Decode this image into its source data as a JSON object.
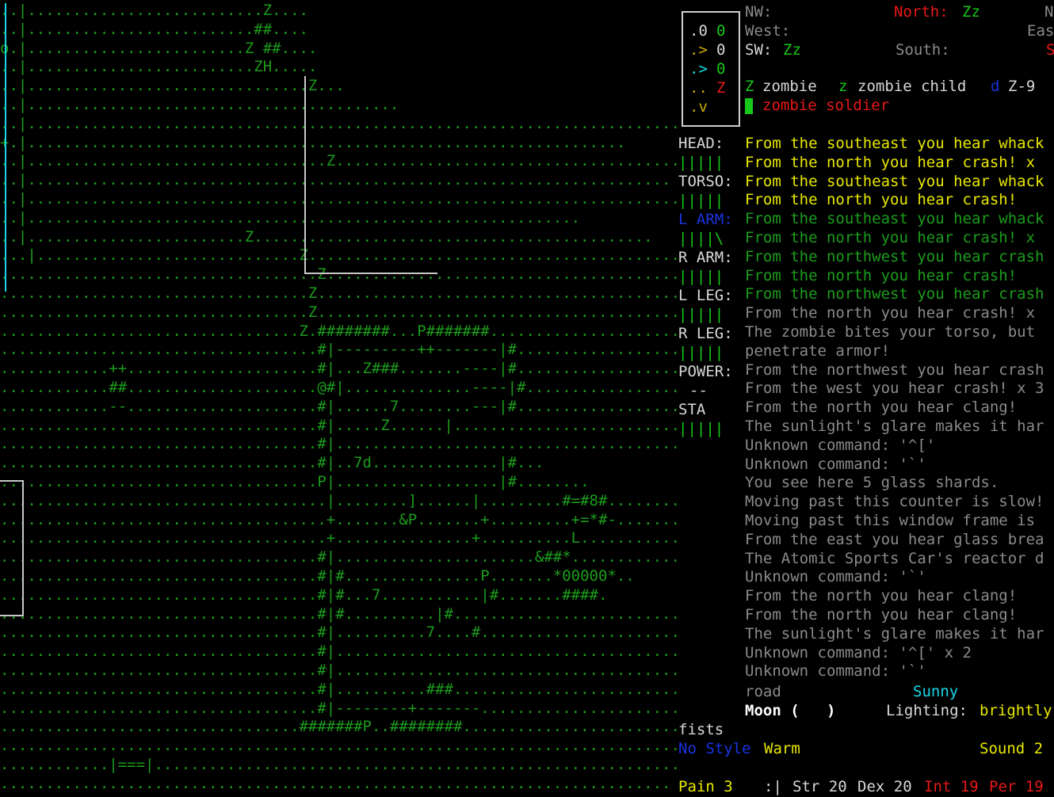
{
  "colors": {
    "background": "#000000",
    "zombie": "#18c818",
    "hostile": "#e81818",
    "warning": "#e8e800",
    "info": "#18d8e8",
    "old_message": "#8a8a8a",
    "player": "#ffffff"
  },
  "map": {
    "rows": [
      {
        "text": "..|..........................Z....",
        "color": "dg"
      },
      {
        "text": "..|.........................##....",
        "color": "dg"
      },
      {
        "text": "o.|........................Z ##....",
        "color": "dg"
      },
      {
        "text": "..|.........................ZH.....",
        "color": "dg"
      },
      {
        "text": "..|...............................Z...",
        "color": "dg"
      },
      {
        "text": "..|.........................................",
        "color": "dg"
      },
      {
        "text": "..|............................................................................",
        "color": "dg"
      },
      {
        "text": "+.|..................................................................",
        "color": "dg"
      },
      {
        "text": "..|.................................Z.........................................",
        "color": "dg"
      },
      {
        "text": "..|.......................................................................",
        "color": "dg"
      },
      {
        "text": "..|............................................................................",
        "color": "dg"
      },
      {
        "text": "..|.............................................................",
        "color": "dg"
      },
      {
        "text": "..|........................Z............................................",
        "color": "dg"
      },
      {
        "text": "...|.............................Z.............................................",
        "color": "dg"
      },
      {
        "text": "...................................Z...........................................",
        "color": "dg"
      },
      {
        "text": "..................................Z............................................",
        "color": "dg"
      },
      {
        "text": "..................................Z.........................................",
        "color": "dg"
      },
      {
        "text": ".................................Z.########...P#######...........................",
        "color": "dg"
      },
      {
        "text": "...................................#|---------++-------|#...........................",
        "color": "dg"
      },
      {
        "text": "............++.....................#|...Z###.......----|#..........................",
        "color": "dg"
      },
      {
        "text": "............##.....................@#|..............----|#.........................",
        "color": "dg"
      },
      {
        "text": "............--.....................#|......7........---|#.........................",
        "color": "dg"
      },
      {
        "text": "...................................#|.....Z......|...........................",
        "color": "dg"
      },
      {
        "text": "...................................#|.........................................",
        "color": "dg"
      },
      {
        "text": "...................................#|..7d..............|#...",
        "color": "dg"
      },
      {
        "text": "...................................P|..................|#........",
        "color": "dg"
      },
      {
        "text": "....................................|........]......|.........#=#8#.............",
        "color": "dg"
      },
      {
        "text": "....................................+.......&P.......+.........+=*#-.............",
        "color": "dg"
      },
      {
        "text": "....................................+...............+..........L.....................",
        "color": "dg"
      },
      {
        "text": "...................................#|......................&##*...............",
        "color": "dg"
      },
      {
        "text": "...................................#|#...............P.......*00000*..",
        "color": "dg"
      },
      {
        "text": "...................................#|#...7...........|#.......####.",
        "color": "dg"
      },
      {
        "text": "...................................#|#..........|#............................",
        "color": "dg"
      },
      {
        "text": "...................................#|..........7....#..........................",
        "color": "dg"
      },
      {
        "text": "...................................#|........................................",
        "color": "dg"
      },
      {
        "text": "...................................#|........................................",
        "color": "dg"
      },
      {
        "text": "...................................#|..........###..............................",
        "color": "dg"
      },
      {
        "text": "...................................#|--------+-------..........................",
        "color": "dg"
      },
      {
        "text": ".................................#######P..########...........................",
        "color": "dg"
      },
      {
        "text": "...........................................................................",
        "color": "dg"
      },
      {
        "text": "............|===|..........................................................",
        "color": "dg"
      },
      {
        "text": "..........................................................................",
        "color": "dg"
      }
    ]
  },
  "minimap": {
    "cells": [
      {
        "text": ".0",
        "color": "w"
      },
      {
        "text": ".>",
        "color": "br"
      },
      {
        "text": ".>",
        "color": "c"
      },
      {
        "text": "..",
        "color": "br"
      },
      {
        "text": ".v",
        "color": "br"
      }
    ],
    "col2": [
      {
        "text": "0",
        "color": "g"
      },
      {
        "text": "0",
        "color": "w"
      },
      {
        "text": "0",
        "color": "g"
      },
      {
        "text": "Z",
        "color": "r"
      },
      {
        "text": "",
        "color": "w"
      }
    ]
  },
  "compass": {
    "nw_label": "NW:",
    "north_label": "North:",
    "north_value": "Zz",
    "ne_label": "N",
    "west_label": "West:",
    "east_label": "Eas",
    "sw_label": "SW:",
    "sw_value": "Zz",
    "south_label": "South:",
    "se_label": "S"
  },
  "monsters": [
    {
      "glyph": "Z",
      "name": "zombie",
      "glyph_color": "g"
    },
    {
      "glyph": "z",
      "name": "zombie child",
      "glyph_color": "g"
    },
    {
      "glyph": "d",
      "name": "Z-9",
      "glyph_color": "b"
    }
  ],
  "monsters_line2": {
    "name": "zombie soldier"
  },
  "body": {
    "head_label": "HEAD:",
    "head_bar": "|||||",
    "torso_label": "TORSO:",
    "torso_bar": "|||||",
    "larm_label": "L ARM:",
    "larm_bar": "||||\\",
    "rarm_label": "R ARM:",
    "rarm_bar": "|||||",
    "lleg_label": "L LEG:",
    "lleg_bar": "|||||",
    "rleg_label": "R LEG:",
    "rleg_bar": "|||||",
    "power_label": "POWER:",
    "power_value": "--",
    "sta_label": "STA",
    "sta_bar": "|||||"
  },
  "messages": [
    {
      "text": "From the southeast you hear whack",
      "color": "y"
    },
    {
      "text": "From the north you hear crash! x",
      "color": "y"
    },
    {
      "text": "From the southeast you hear whack",
      "color": "y"
    },
    {
      "text": "From the north you hear crash!",
      "color": "y"
    },
    {
      "text": "From the southeast you hear whack",
      "color": "dg"
    },
    {
      "text": "From the north you hear crash! x",
      "color": "dg"
    },
    {
      "text": "From the northwest you hear crash",
      "color": "dg"
    },
    {
      "text": "From the north you hear crash!",
      "color": "dg"
    },
    {
      "text": "From the northwest you hear crash",
      "color": "dg"
    },
    {
      "text": "From the north you hear crash! x",
      "color": "gr"
    },
    {
      "text": "The zombie bites your torso, but",
      "color": "gr"
    },
    {
      "text": "penetrate armor!",
      "color": "gr"
    },
    {
      "text": "From the northwest you hear crash",
      "color": "gr"
    },
    {
      "text": "From the west you hear crash! x 3",
      "color": "gr"
    },
    {
      "text": "From the north you hear clang!",
      "color": "gr"
    },
    {
      "text": "The sunlight's glare makes it har",
      "color": "gr"
    },
    {
      "text": "Unknown command: '^['",
      "color": "gr"
    },
    {
      "text": "Unknown command: '`'",
      "color": "gr"
    },
    {
      "text": "You see here 5 glass shards.",
      "color": "gr"
    },
    {
      "text": "Moving past this counter is slow!",
      "color": "gr"
    },
    {
      "text": "Moving past this window frame is",
      "color": "gr"
    },
    {
      "text": "From the east you hear glass brea",
      "color": "gr"
    },
    {
      "text": "The Atomic Sports Car's reactor d",
      "color": "gr"
    },
    {
      "text": "Unknown command: '`'",
      "color": "gr"
    },
    {
      "text": "From the north you hear clang!",
      "color": "gr"
    },
    {
      "text": "From the north you hear clang!",
      "color": "gr"
    },
    {
      "text": "The sunlight's glare makes it har",
      "color": "gr"
    },
    {
      "text": "Unknown command: '^[' x 2",
      "color": "gr"
    },
    {
      "text": "Unknown command: '`'",
      "color": "gr"
    }
  ],
  "status": {
    "terrain": "road",
    "weather": "Sunny",
    "moon": "Moon (   )",
    "lighting_label": "Lighting:",
    "lighting_value": "brightly",
    "weapon": "fists",
    "style": "No Style",
    "temperature": "Warm",
    "sound": "Sound 2",
    "pain": "Pain 3",
    "face": ":|",
    "str": "Str 20",
    "dex": "Dex 20",
    "int": "Int 19",
    "per": "Per 19"
  }
}
